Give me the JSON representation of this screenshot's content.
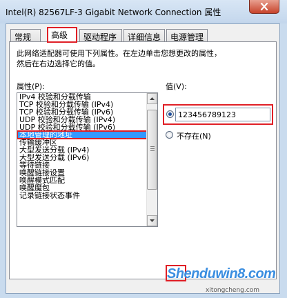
{
  "window": {
    "title": "Intel(R) 82567LF-3 Gigabit Network Connection 属性"
  },
  "tabs": [
    {
      "label": "常规",
      "active": false
    },
    {
      "label": "高级",
      "active": true
    },
    {
      "label": "驱动程序",
      "active": false
    },
    {
      "label": "详细信息",
      "active": false
    },
    {
      "label": "电源管理",
      "active": false
    }
  ],
  "advanced": {
    "description": "此网络适配器可使用下列属性。在左边单击您想更改的属性，\n然后在右边选择它的值。",
    "property_label": "属性(P):",
    "value_label": "值(V):",
    "properties": [
      "IPv4 校验和分载传输",
      "TCP 校验和分载传输 (IPv4)",
      "TCP 校验和分载传输 (IPv6)",
      "UDP 校验和分载传输 (IPv4)",
      "UDP 校验和分载传输 (IPv6)",
      "本地管理的地址",
      "传输缓冲区",
      "大型发送分载 (IPv4)",
      "大型发送分载 (IPv6)",
      "等待链接",
      "唤醒链接设置",
      "唤醒模式匹配",
      "唤醒魔包",
      "记录链接状态事件"
    ],
    "selected_index": 5,
    "value_input": "123456789123",
    "not_present_label": "不存在(N)"
  },
  "watermark": {
    "main": "Shenduwin8.com",
    "sub": "xitongcheng.com"
  },
  "colors": {
    "highlight_red": "#e01f26",
    "selection_blue": "#3399ff",
    "close_red": "#c7432b"
  }
}
